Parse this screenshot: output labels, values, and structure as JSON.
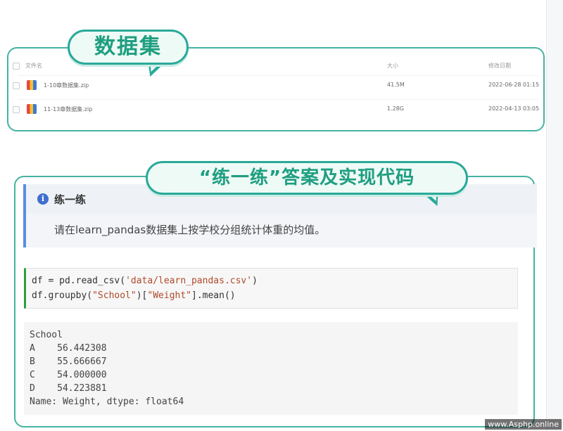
{
  "file_section": {
    "title": "数据集",
    "header": {
      "name": "文件名",
      "size": "大小",
      "date": "修改日期"
    },
    "files": [
      {
        "name": "1-10章数据集.zip",
        "size": "41.5M",
        "date": "2022-06-28 01:15"
      },
      {
        "name": "11-13章数据集.zip",
        "size": "1.28G",
        "date": "2022-04-13 03:05"
      }
    ]
  },
  "answer_section": {
    "title": "“练一练”答案及实现代码",
    "note": {
      "title": "练一练",
      "body": "请在learn_pandas数据集上按学校分组统计体重的均值。"
    },
    "code": {
      "line1_pre": "df = pd.read_csv(",
      "line1_str": "'data/learn_pandas.csv'",
      "line1_post": ")",
      "line2_pre": "df.groupby(",
      "line2_str1": "\"School\"",
      "line2_mid": ")[",
      "line2_str2": "\"Weight\"",
      "line2_post": "].mean()"
    },
    "output": [
      "School",
      "A    56.442308",
      "B    55.666667",
      "C    54.000000",
      "D    54.223881",
      "Name: Weight, dtype: float64"
    ]
  },
  "watermark": "www.Asphp.online",
  "colors": {
    "accent_teal": "#2aa99a",
    "note_blue": "#5b8de0",
    "code_green": "#2e9c3e"
  }
}
